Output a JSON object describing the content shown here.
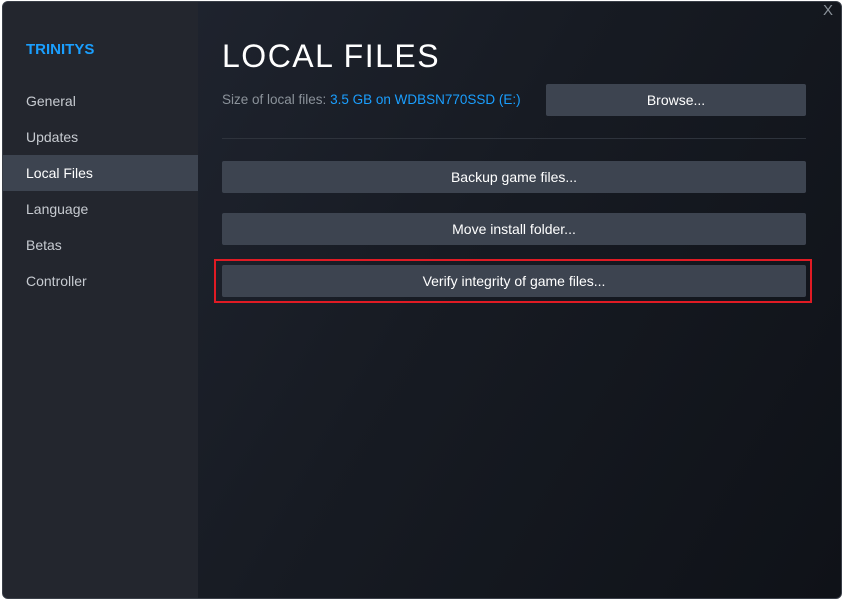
{
  "sidebar": {
    "title": "TRINITYS",
    "items": [
      "General",
      "Updates",
      "Local Files",
      "Language",
      "Betas",
      "Controller"
    ],
    "active": "Local Files"
  },
  "close_label": "X",
  "main": {
    "title": "LOCAL FILES",
    "size_label": "Size of local files:",
    "size_value": "3.5 GB on WDBSN770SSD (E:)",
    "browse": "Browse...",
    "backup": "Backup game files...",
    "move": "Move install folder...",
    "verify": "Verify integrity of game files..."
  },
  "colors": {
    "accent": "#1a9fff",
    "highlight": "#e01b24"
  }
}
